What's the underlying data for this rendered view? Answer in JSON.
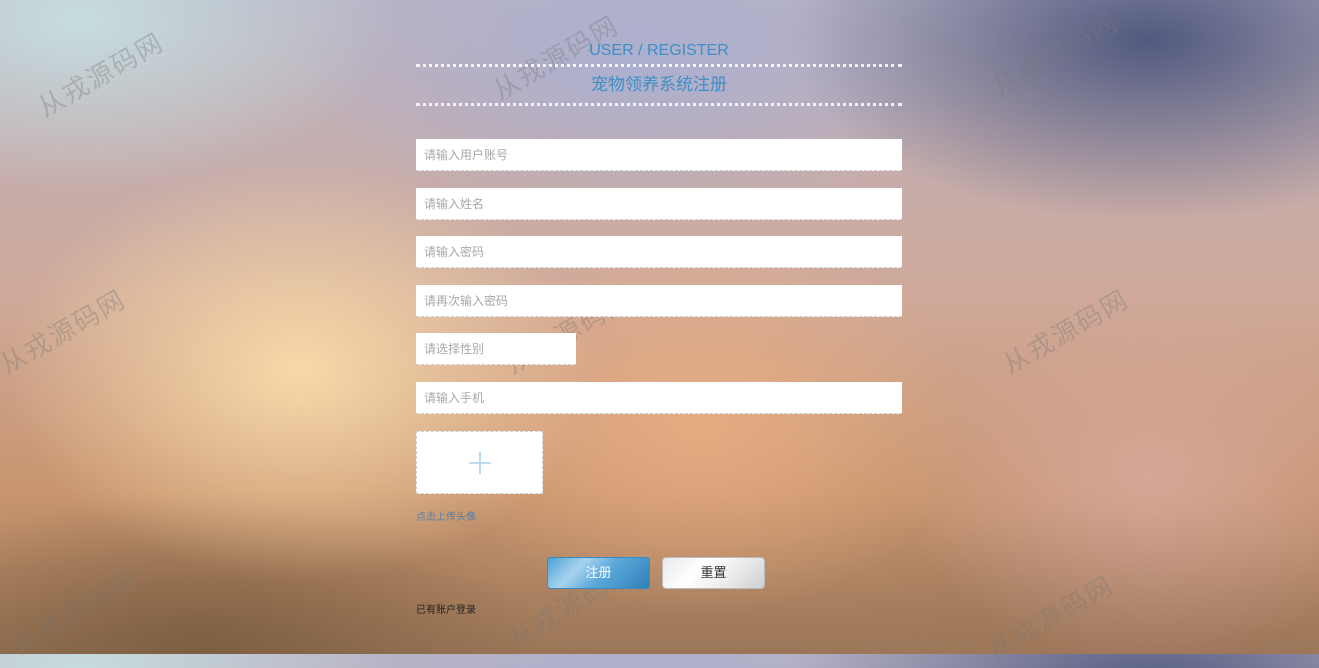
{
  "header": {
    "title_en": "USER / REGISTER",
    "title_cn": "宠物领养系统注册"
  },
  "form": {
    "account_placeholder": "请输入用户账号",
    "name_placeholder": "请输入姓名",
    "password_placeholder": "请输入密码",
    "confirm_password_placeholder": "请再次输入密码",
    "gender_placeholder": "请选择性别",
    "phone_placeholder": "请输入手机",
    "upload_label": "点击上传头像"
  },
  "actions": {
    "register_label": "注册",
    "reset_label": "重置",
    "login_link": "已有账户登录"
  },
  "watermark": {
    "text": "从戎源码网"
  },
  "colors": {
    "accent": "#3d8fc5"
  },
  "icons": {
    "upload": "plus-icon"
  }
}
